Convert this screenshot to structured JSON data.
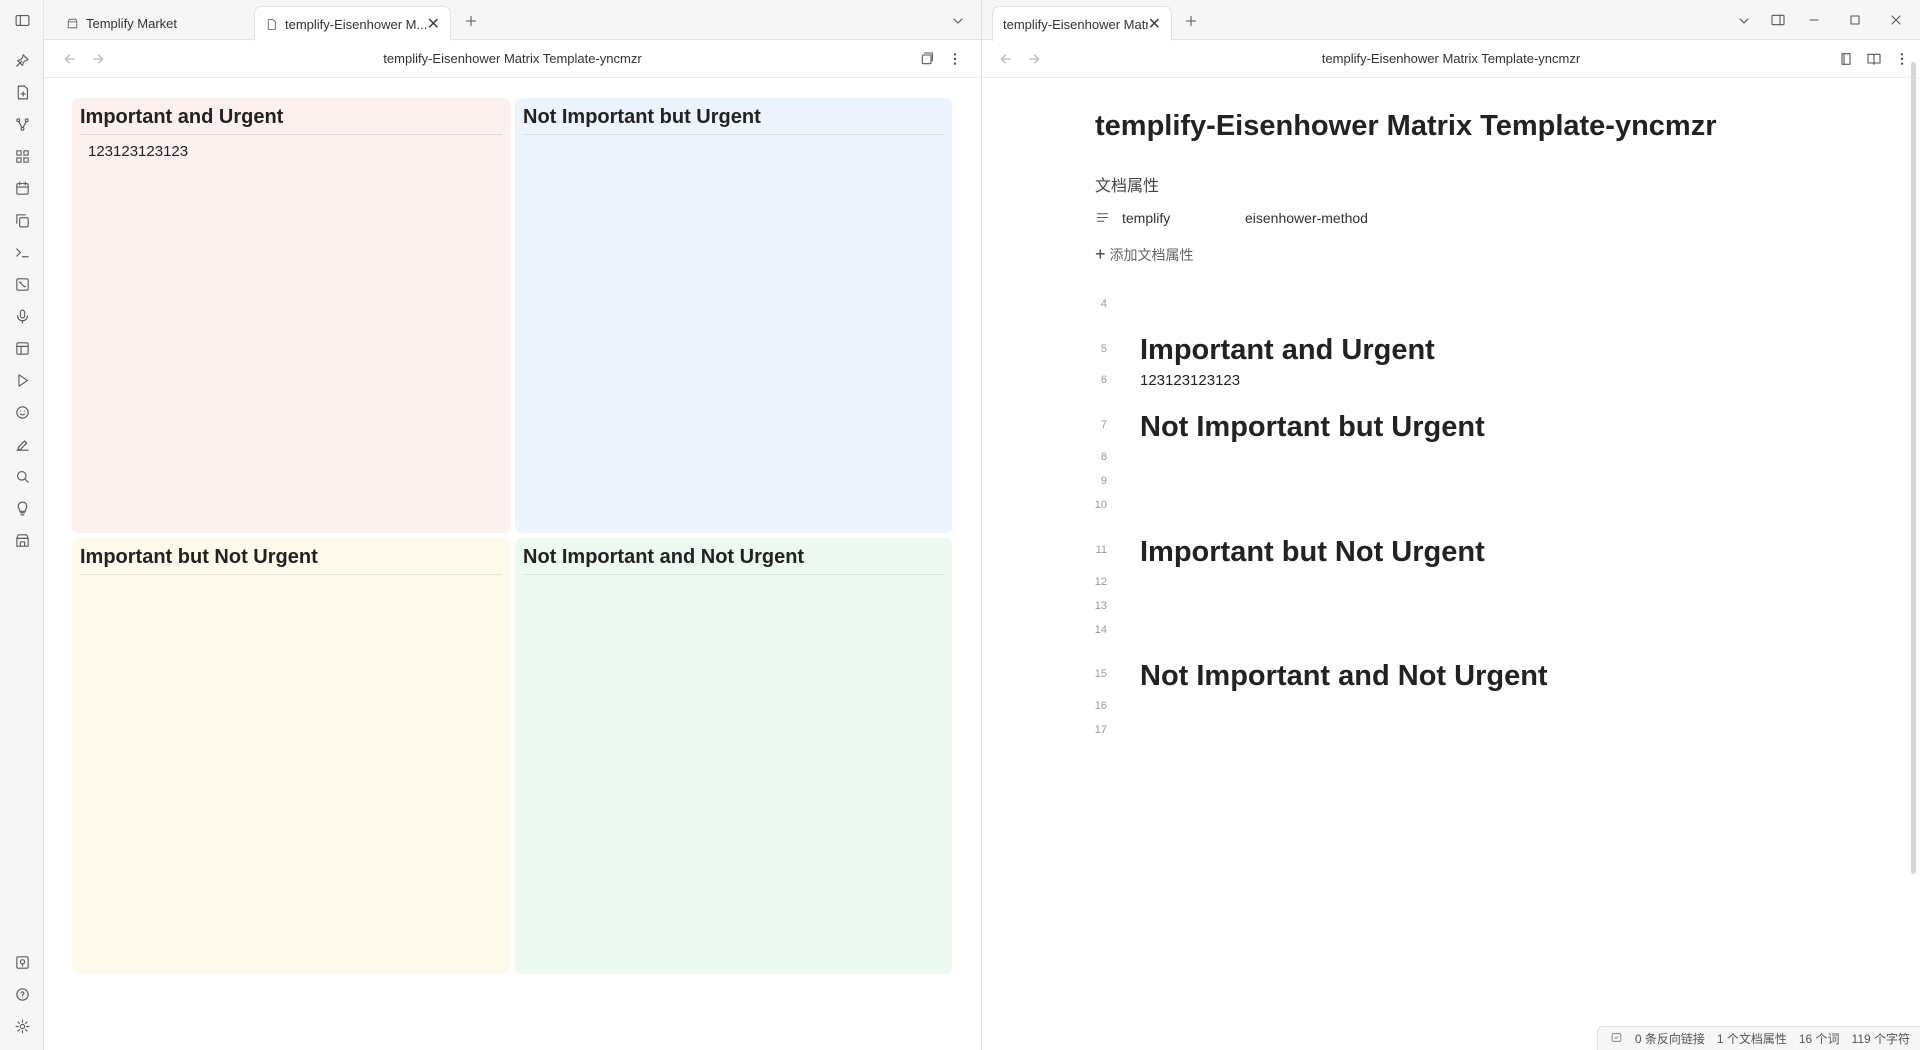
{
  "ribbon": {
    "items": [
      "sidebar-toggle-icon",
      "plugin-icon",
      "new-file-icon",
      "graph-icon",
      "dashboard-icon",
      "calendar-icon",
      "copy-icon",
      "terminal-icon",
      "canvas-icon",
      "microphone-icon",
      "layout-icon",
      "play-icon",
      "smiley-icon",
      "sign-icon",
      "search-icon",
      "lightbulb-icon",
      "store-icon",
      "vault-icon",
      "help-icon",
      "settings-icon"
    ]
  },
  "left": {
    "tabs": [
      {
        "label": "Templify Market",
        "icon": "store-icon"
      },
      {
        "label": "templify-Eisenhower M...",
        "icon": "file-icon"
      }
    ],
    "nav_title": "templify-Eisenhower Matrix Template-yncmzr",
    "matrix": {
      "q1": {
        "title": "Important and Urgent",
        "content": "123123123123"
      },
      "q2": {
        "title": "Not Important but Urgent",
        "content": ""
      },
      "q3": {
        "title": "Important but Not Urgent",
        "content": ""
      },
      "q4": {
        "title": "Not Important and Not Urgent",
        "content": ""
      }
    }
  },
  "right": {
    "tab_label": "templify-Eisenhower Matri...",
    "nav_title": "templify-Eisenhower Matrix Template-yncmzr",
    "doc_title": "templify-Eisenhower Matrix Template-yncmzr",
    "props_heading": "文档属性",
    "property": {
      "key": "templify",
      "value": "eisenhower-method"
    },
    "add_property": "添加文档属性",
    "lines": {
      "l4": "4",
      "l5": "5",
      "l6": "6",
      "l7": "7",
      "l8": "8",
      "l9": "9",
      "l10": "10",
      "l11": "11",
      "l12": "12",
      "l13": "13",
      "l14": "14",
      "l15": "15",
      "l16": "16",
      "l17": "17"
    },
    "h1": "Important and Urgent",
    "p1": "123123123123",
    "h2": "Not Important but Urgent",
    "h3": "Important but Not Urgent",
    "h4": "Not Important and Not Urgent"
  },
  "status": {
    "backlinks": "0 条反向链接",
    "properties": "1 个文档属性",
    "words": "16 个词",
    "chars": "119 个字符"
  }
}
